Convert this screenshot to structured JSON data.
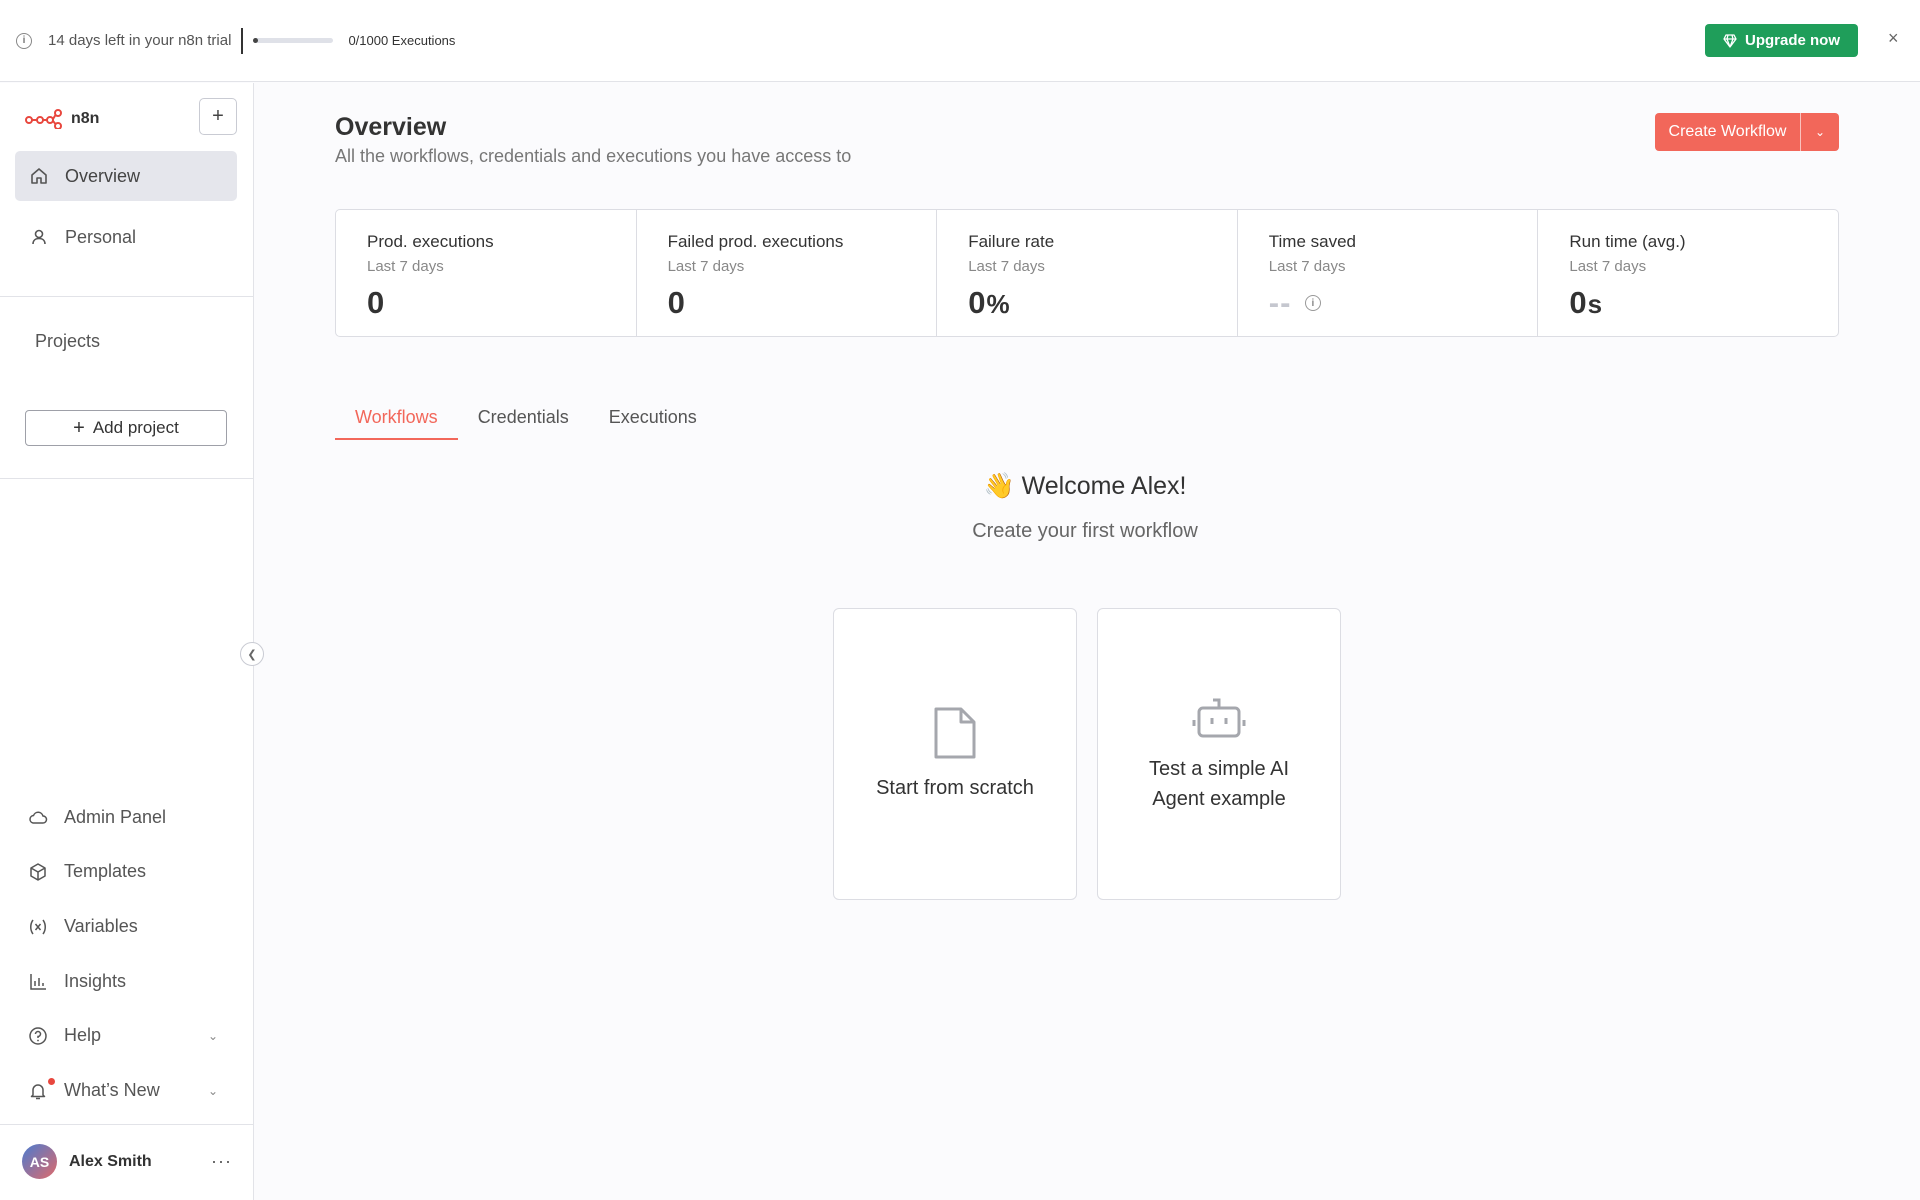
{
  "banner": {
    "trial_text": "14 days left in your n8n trial",
    "executions_text": "0/1000 Executions",
    "executions_progress": 0,
    "upgrade_label": "Upgrade now",
    "close_glyph": "×",
    "info_glyph": "i"
  },
  "sidebar": {
    "logo_text": "n8n",
    "plus_glyph": "+",
    "nav": [
      {
        "label": "Overview",
        "icon": "home-icon",
        "active": true
      },
      {
        "label": "Personal",
        "icon": "user-icon",
        "active": false
      }
    ],
    "projects_label": "Projects",
    "add_project_label": "Add project",
    "bottom": [
      {
        "label": "Admin Panel",
        "icon": "cloud-icon"
      },
      {
        "label": "Templates",
        "icon": "box-icon"
      },
      {
        "label": "Variables",
        "icon": "variable-icon"
      },
      {
        "label": "Insights",
        "icon": "chart-icon"
      },
      {
        "label": "Help",
        "icon": "help-icon"
      },
      {
        "label": "What’s New",
        "icon": "bell-icon"
      }
    ],
    "user": {
      "initials": "AS",
      "name": "Alex Smith",
      "more": "···"
    }
  },
  "main": {
    "title": "Overview",
    "subtitle": "All the workflows, credentials and executions you have access to",
    "create_workflow_label": "Create Workflow",
    "stats": [
      {
        "label": "Prod. executions",
        "sub": "Last 7 days",
        "value": "0",
        "unit": ""
      },
      {
        "label": "Failed prod. executions",
        "sub": "Last 7 days",
        "value": "0",
        "unit": ""
      },
      {
        "label": "Failure rate",
        "sub": "Last 7 days",
        "value": "0",
        "unit": "%"
      },
      {
        "label": "Time saved",
        "sub": "Last 7 days",
        "value": "--",
        "unit": ""
      },
      {
        "label": "Run time (avg.)",
        "sub": "Last 7 days",
        "value": "0",
        "unit": "s"
      }
    ],
    "tabs": [
      {
        "label": "Workflows",
        "active": true
      },
      {
        "label": "Credentials",
        "active": false
      },
      {
        "label": "Executions",
        "active": false
      }
    ],
    "welcome_emoji": "👋",
    "welcome": "Welcome Alex!",
    "welcome_sub": "Create your first workflow",
    "cards": [
      {
        "label": "Start from scratch",
        "icon": "file-icon"
      },
      {
        "label": "Test a simple AI Agent example",
        "icon": "robot-icon"
      }
    ]
  },
  "colors": {
    "accent": "#f2675a",
    "upgrade": "#1f9e5a"
  }
}
